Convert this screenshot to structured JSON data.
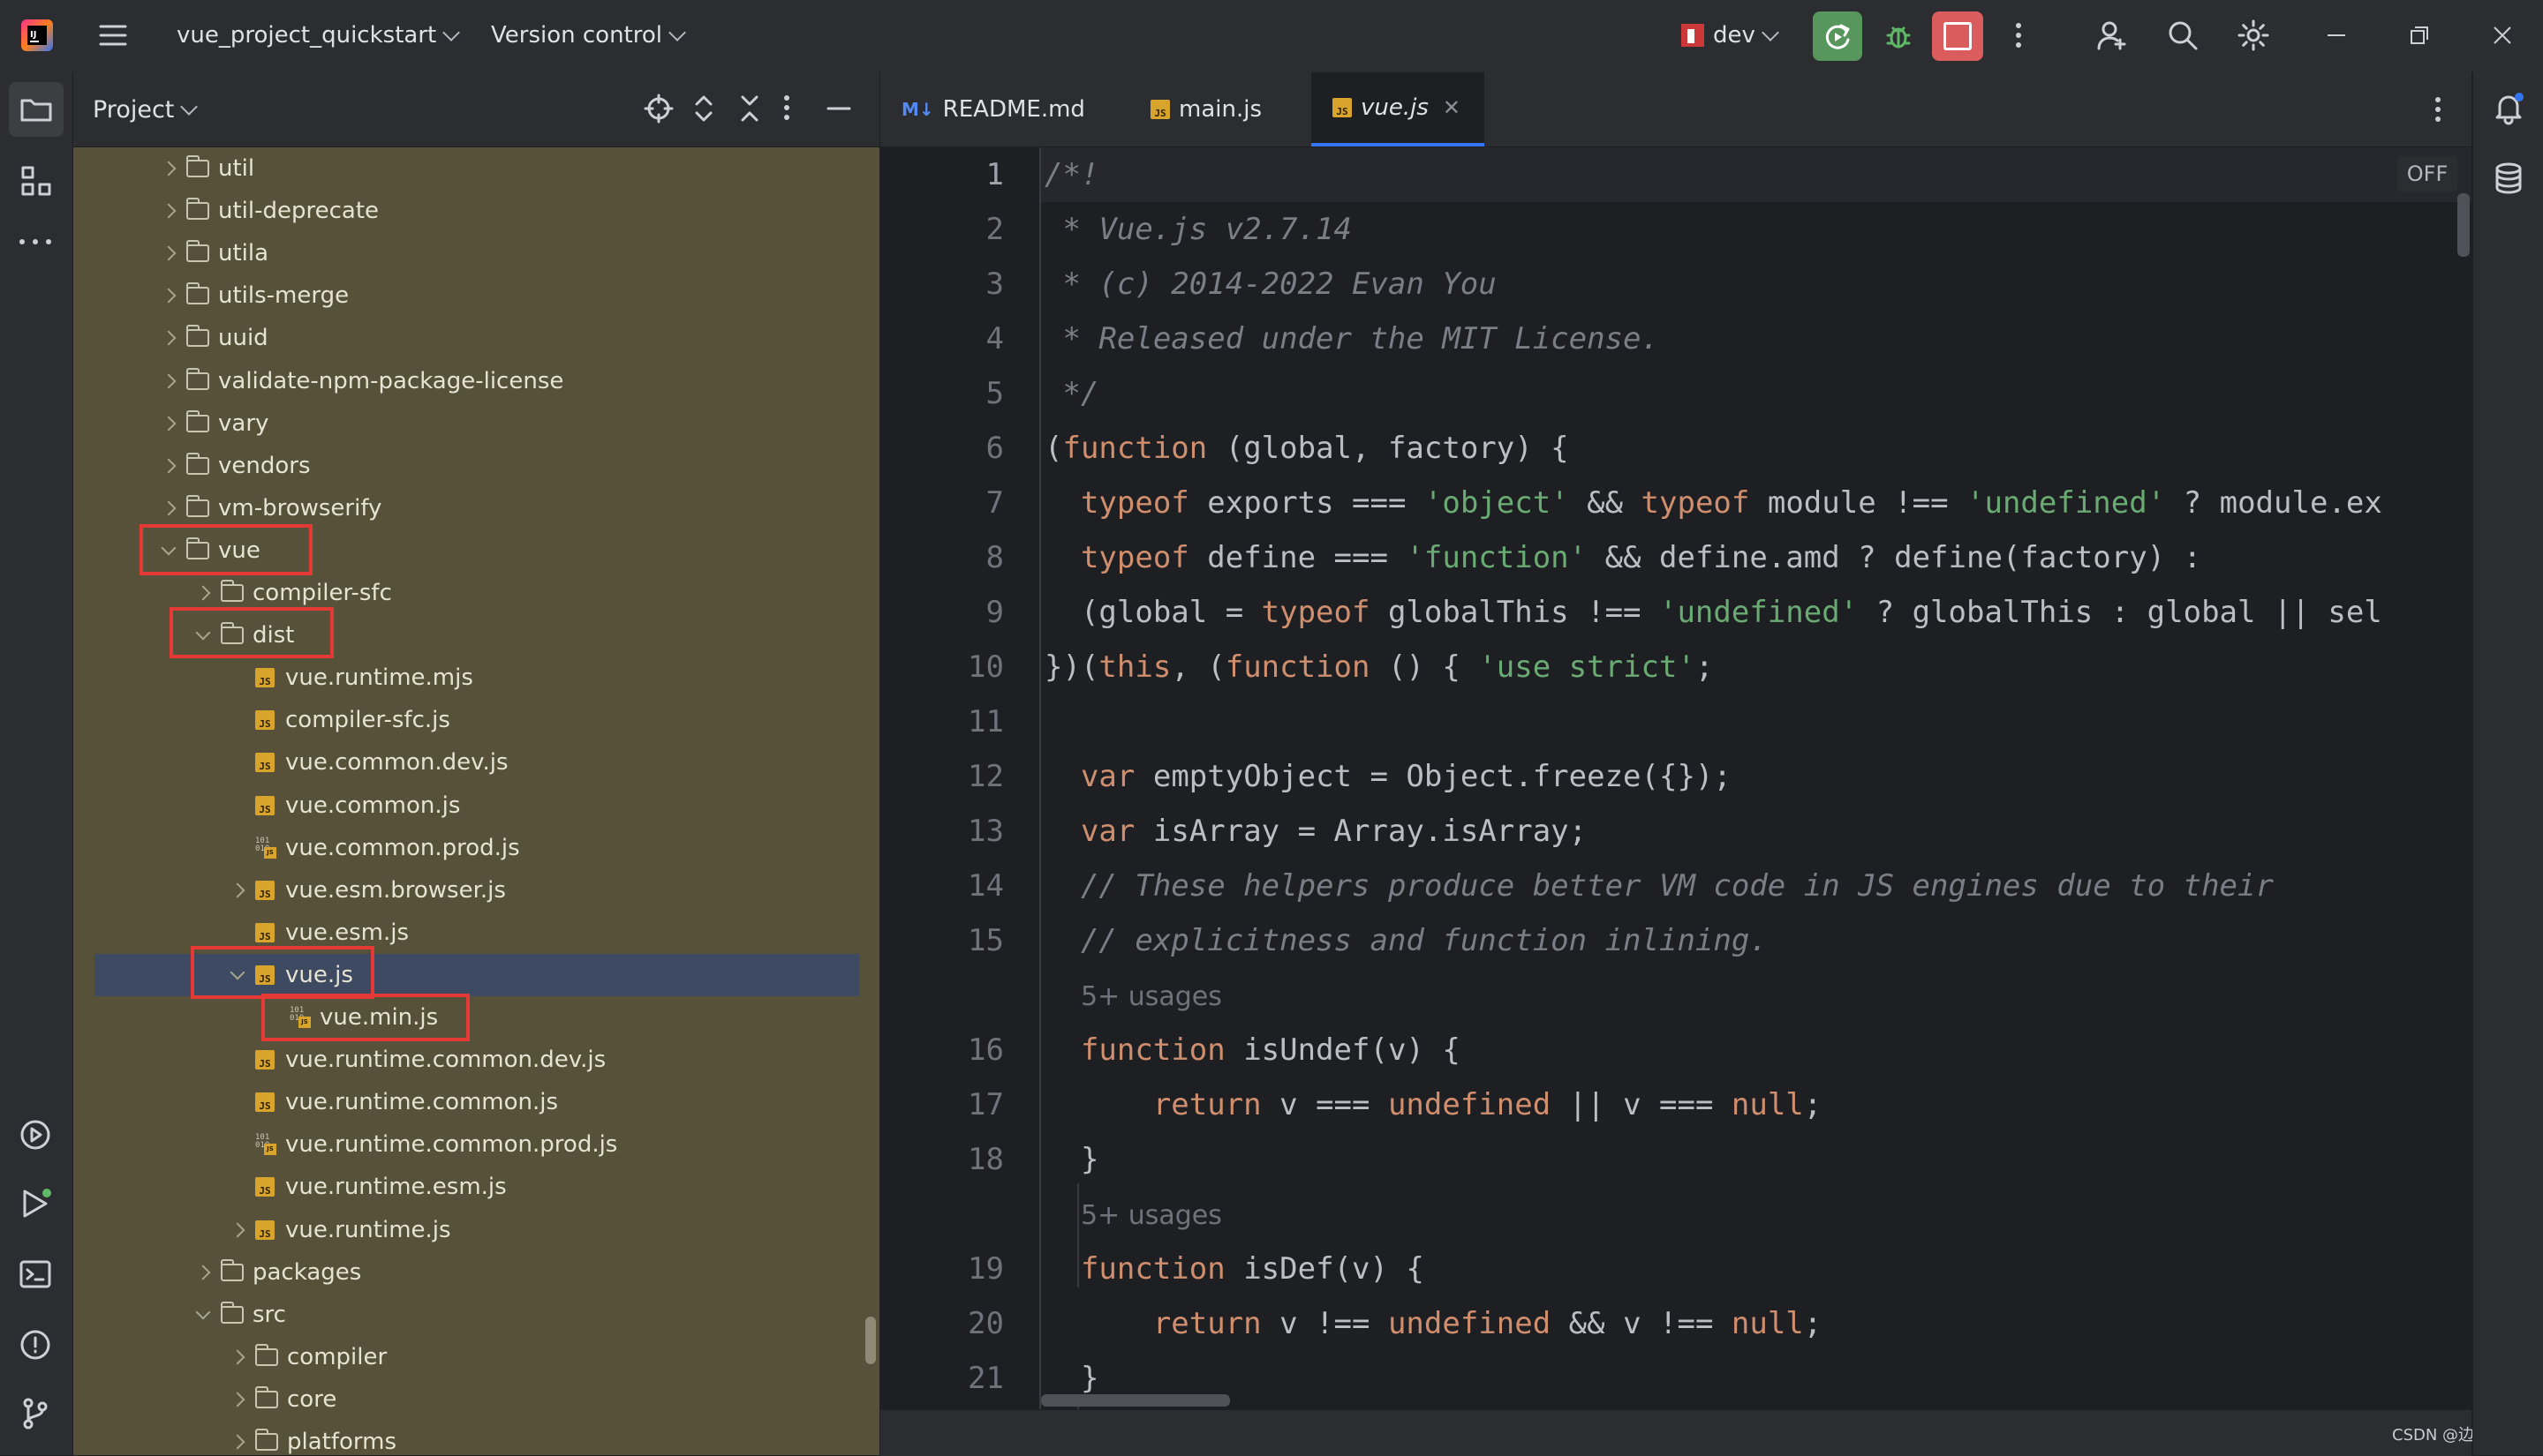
{
  "titlebar": {
    "project_name": "vue_project_quickstart",
    "vcs_label": "Version control",
    "run_config": "dev"
  },
  "project_panel": {
    "title": "Project"
  },
  "tree": [
    {
      "label": "util",
      "type": "folder",
      "depth": 2,
      "expanded": false
    },
    {
      "label": "util-deprecate",
      "type": "folder",
      "depth": 2,
      "expanded": false
    },
    {
      "label": "utila",
      "type": "folder",
      "depth": 2,
      "expanded": false
    },
    {
      "label": "utils-merge",
      "type": "folder",
      "depth": 2,
      "expanded": false
    },
    {
      "label": "uuid",
      "type": "folder",
      "depth": 2,
      "expanded": false
    },
    {
      "label": "validate-npm-package-license",
      "type": "folder",
      "depth": 2,
      "expanded": false
    },
    {
      "label": "vary",
      "type": "folder",
      "depth": 2,
      "expanded": false
    },
    {
      "label": "vendors",
      "type": "folder",
      "depth": 2,
      "expanded": false
    },
    {
      "label": "vm-browserify",
      "type": "folder",
      "depth": 2,
      "expanded": false
    },
    {
      "label": "vue",
      "type": "folder",
      "depth": 2,
      "expanded": true
    },
    {
      "label": "compiler-sfc",
      "type": "folder",
      "depth": 3,
      "expanded": false
    },
    {
      "label": "dist",
      "type": "folder",
      "depth": 3,
      "expanded": true
    },
    {
      "label": "vue.runtime.mjs",
      "type": "js",
      "depth": 4
    },
    {
      "label": "compiler-sfc.js",
      "type": "js",
      "depth": 4
    },
    {
      "label": "vue.common.dev.js",
      "type": "js",
      "depth": 4
    },
    {
      "label": "vue.common.js",
      "type": "js",
      "depth": 4
    },
    {
      "label": "vue.common.prod.js",
      "type": "bin",
      "depth": 4
    },
    {
      "label": "vue.esm.browser.js",
      "type": "js",
      "depth": 4,
      "expanded": false
    },
    {
      "label": "vue.esm.js",
      "type": "js",
      "depth": 4
    },
    {
      "label": "vue.js",
      "type": "js",
      "depth": 4,
      "expanded": true,
      "selected": true
    },
    {
      "label": "vue.min.js",
      "type": "bin",
      "depth": 5
    },
    {
      "label": "vue.runtime.common.dev.js",
      "type": "js",
      "depth": 4
    },
    {
      "label": "vue.runtime.common.js",
      "type": "js",
      "depth": 4
    },
    {
      "label": "vue.runtime.common.prod.js",
      "type": "bin",
      "depth": 4
    },
    {
      "label": "vue.runtime.esm.js",
      "type": "js",
      "depth": 4
    },
    {
      "label": "vue.runtime.js",
      "type": "js",
      "depth": 4,
      "expanded": false
    },
    {
      "label": "packages",
      "type": "folder",
      "depth": 3,
      "expanded": false
    },
    {
      "label": "src",
      "type": "folder",
      "depth": 3,
      "expanded": true
    },
    {
      "label": "compiler",
      "type": "folder",
      "depth": 4,
      "expanded": false
    },
    {
      "label": "core",
      "type": "folder",
      "depth": 4,
      "expanded": false
    },
    {
      "label": "platforms",
      "type": "folder",
      "depth": 4,
      "expanded": false
    }
  ],
  "tabs": [
    {
      "label": "README.md",
      "icon": "M↓"
    },
    {
      "label": "main.js",
      "icon": "JS"
    },
    {
      "label": "vue.js",
      "icon": "JS",
      "active": true
    }
  ],
  "editor": {
    "off_badge": "OFF",
    "usage_hint": "5+ usages",
    "lines": [
      {
        "n": "1",
        "html": "<span class='cm'>/*!</span>"
      },
      {
        "n": "2",
        "html": "<span class='cm'> * Vue.js v2.7.14</span>"
      },
      {
        "n": "3",
        "html": "<span class='cm'> * (c) 2014-2022 Evan You</span>"
      },
      {
        "n": "4",
        "html": "<span class='cm'> * Released under the MIT License.</span>"
      },
      {
        "n": "5",
        "html": "<span class='cm'> */</span>"
      },
      {
        "n": "6",
        "html": "(<span class='kw'>function</span> (global, factory) {"
      },
      {
        "n": "7",
        "html": "  <span class='kw'>typeof</span> exports === <span class='st'>'object'</span> &amp;&amp; <span class='kw'>typeof</span> module !== <span class='st'>'undefined'</span> ? module.ex"
      },
      {
        "n": "8",
        "html": "  <span class='kw'>typeof</span> define === <span class='st'>'function'</span> &amp;&amp; define.amd ? define(factory) :"
      },
      {
        "n": "9",
        "html": "  (global = <span class='kw'>typeof</span> globalThis !== <span class='st'>'undefined'</span> ? globalThis : global || sel"
      },
      {
        "n": "10",
        "html": "})(<span class='kw'>this</span>, (<span class='kw'>function</span> () { <span class='st'>'use strict'</span>;"
      },
      {
        "n": "11",
        "html": ""
      },
      {
        "n": "12",
        "html": "  <span class='kw'>var</span> emptyObject = Object.freeze({});"
      },
      {
        "n": "13",
        "html": "  <span class='kw'>var</span> isArray = Array.isArray;"
      },
      {
        "n": "14",
        "html": "  <span class='cm'>// These helpers produce better VM code in JS engines due to their</span>"
      },
      {
        "n": "15",
        "html": "  <span class='cm'>// explicitness and function inlining.</span>"
      },
      {
        "n": "",
        "usage": true
      },
      {
        "n": "16",
        "html": "  <span class='kw'>function</span> isUndef(v) {"
      },
      {
        "n": "17",
        "html": "      <span class='kw'>return</span> v === <span class='kw'>undefined</span> || v === <span class='kw'>null</span>;"
      },
      {
        "n": "18",
        "html": "  }"
      },
      {
        "n": "",
        "usage": true
      },
      {
        "n": "19",
        "html": "  <span class='kw'>function</span> isDef(v) {"
      },
      {
        "n": "20",
        "html": "      <span class='kw'>return</span> v !== <span class='kw'>undefined</span> &amp;&amp; v !== <span class='kw'>null</span>;"
      },
      {
        "n": "21",
        "html": "  }"
      }
    ]
  },
  "watermark": "CSDN @边境矢梦°"
}
